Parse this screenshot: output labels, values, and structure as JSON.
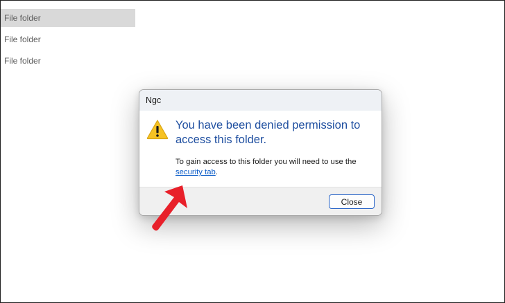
{
  "file_list": {
    "items": [
      {
        "label": "File folder"
      },
      {
        "label": "File folder"
      },
      {
        "label": "File folder"
      }
    ]
  },
  "dialog": {
    "title": "Ngc",
    "icon": "warning-icon",
    "main_instruction": "You have been denied permission to access this folder.",
    "body_prefix": "To gain access to this folder you will need to use the ",
    "link_text": "security tab",
    "body_suffix": ".",
    "close_label": "Close"
  },
  "annotation": {
    "icon": "red-pointer-arrow",
    "color": "#e8202a"
  },
  "colors": {
    "instruction_blue": "#1f4fa0",
    "link_blue": "#0a5bc7",
    "warning_yellow": "#f6c223",
    "button_border": "#2a66c8",
    "selection_gray": "#d9d9d9"
  }
}
